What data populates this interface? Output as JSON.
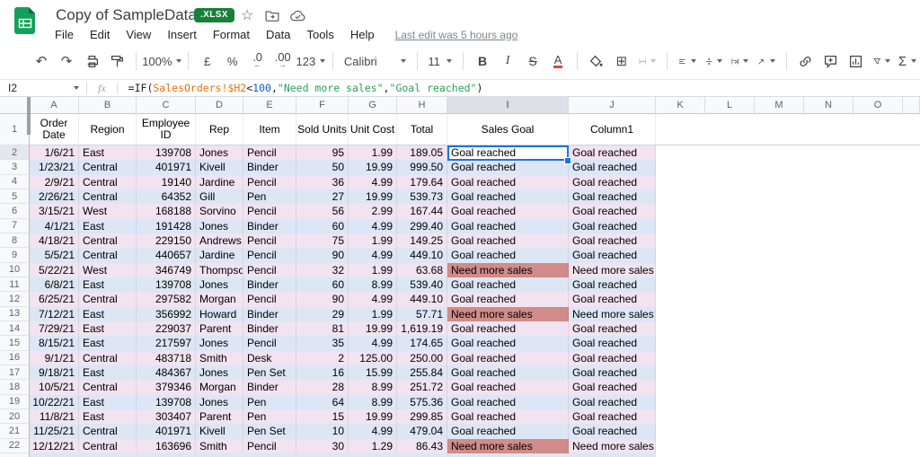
{
  "titlebar": {
    "title": "Copy of SampleData",
    "badge": ".XLSX"
  },
  "icons": {
    "star": "☆",
    "undo": "↶",
    "redo": "↷",
    "borders": "⊞",
    "sum": "Σ",
    "arrow_left": "←",
    "arrow_right": "→"
  },
  "menubar": {
    "items": [
      "File",
      "Edit",
      "View",
      "Insert",
      "Format",
      "Data",
      "Tools",
      "Help"
    ],
    "last_edit": "Last edit was 5 hours ago"
  },
  "toolbar": {
    "zoom": "100%",
    "currency": "£",
    "percent": "%",
    "decrease_decimal": ".0",
    "increase_decimal": ".00",
    "number_format": "123",
    "font": "Calibri",
    "font_size": "11",
    "bold": "B",
    "italic": "I",
    "strikethrough": "S",
    "text_color": "A"
  },
  "formula_bar": {
    "cell_ref": "I2",
    "fx_label": "fx",
    "formula_parts": [
      {
        "t": "=IF(",
        "c": "plain"
      },
      {
        "t": "SalesOrders!$H2",
        "c": "range"
      },
      {
        "t": "<",
        "c": "plain"
      },
      {
        "t": "100",
        "c": "number"
      },
      {
        "t": ",",
        "c": "plain"
      },
      {
        "t": "\"Need more sales\"",
        "c": "string"
      },
      {
        "t": ",",
        "c": "plain"
      },
      {
        "t": "\"Goal reached\"",
        "c": "string"
      },
      {
        "t": ")",
        "c": "plain"
      }
    ]
  },
  "colors": {
    "band_pink": "#f1e3f0",
    "band_blue": "#dce6f5",
    "alert_red": "#d18b88",
    "selection": "#1a73e8",
    "badge_green": "#188038",
    "selected_cell_bg": "#ffffff",
    "formula_plain": "#202124",
    "formula_range": "#e8710a",
    "formula_number": "#1155cc",
    "formula_string": "#2e9e57"
  },
  "sheet": {
    "column_letters": [
      "A",
      "B",
      "C",
      "D",
      "E",
      "F",
      "G",
      "H",
      "I",
      "J",
      "K",
      "L",
      "M",
      "N",
      "O"
    ],
    "selected_column": "I",
    "selected_row": 2,
    "selected_cell": "I2",
    "alert_text": "Need more sales",
    "header_row": [
      "Order Date",
      "Region",
      "Employee ID",
      "Rep",
      "Item",
      "Sold Units",
      "Unit Cost",
      "Total",
      "Sales Goal",
      "Column1"
    ],
    "rows": [
      [
        "1/6/21",
        "East",
        "139708",
        "Jones",
        "Pencil",
        "95",
        "1.99",
        "189.05",
        "Goal reached",
        "Goal reached"
      ],
      [
        "1/23/21",
        "Central",
        "401971",
        "Kivell",
        "Binder",
        "50",
        "19.99",
        "999.50",
        "Goal reached",
        "Goal reached"
      ],
      [
        "2/9/21",
        "Central",
        "19140",
        "Jardine",
        "Pencil",
        "36",
        "4.99",
        "179.64",
        "Goal reached",
        "Goal reached"
      ],
      [
        "2/26/21",
        "Central",
        "64352",
        "Gill",
        "Pen",
        "27",
        "19.99",
        "539.73",
        "Goal reached",
        "Goal reached"
      ],
      [
        "3/15/21",
        "West",
        "168188",
        "Sorvino",
        "Pencil",
        "56",
        "2.99",
        "167.44",
        "Goal reached",
        "Goal reached"
      ],
      [
        "4/1/21",
        "East",
        "191428",
        "Jones",
        "Binder",
        "60",
        "4.99",
        "299.40",
        "Goal reached",
        "Goal reached"
      ],
      [
        "4/18/21",
        "Central",
        "229150",
        "Andrews",
        "Pencil",
        "75",
        "1.99",
        "149.25",
        "Goal reached",
        "Goal reached"
      ],
      [
        "5/5/21",
        "Central",
        "440657",
        "Jardine",
        "Pencil",
        "90",
        "4.99",
        "449.10",
        "Goal reached",
        "Goal reached"
      ],
      [
        "5/22/21",
        "West",
        "346749",
        "Thompson",
        "Pencil",
        "32",
        "1.99",
        "63.68",
        "Need more sales",
        "Need more sales"
      ],
      [
        "6/8/21",
        "East",
        "139708",
        "Jones",
        "Binder",
        "60",
        "8.99",
        "539.40",
        "Goal reached",
        "Goal reached"
      ],
      [
        "6/25/21",
        "Central",
        "297582",
        "Morgan",
        "Pencil",
        "90",
        "4.99",
        "449.10",
        "Goal reached",
        "Goal reached"
      ],
      [
        "7/12/21",
        "East",
        "356992",
        "Howard",
        "Binder",
        "29",
        "1.99",
        "57.71",
        "Need more sales",
        "Need more sales"
      ],
      [
        "7/29/21",
        "East",
        "229037",
        "Parent",
        "Binder",
        "81",
        "19.99",
        "1,619.19",
        "Goal reached",
        "Goal reached"
      ],
      [
        "8/15/21",
        "East",
        "217597",
        "Jones",
        "Pencil",
        "35",
        "4.99",
        "174.65",
        "Goal reached",
        "Goal reached"
      ],
      [
        "9/1/21",
        "Central",
        "483718",
        "Smith",
        "Desk",
        "2",
        "125.00",
        "250.00",
        "Goal reached",
        "Goal reached"
      ],
      [
        "9/18/21",
        "East",
        "484367",
        "Jones",
        "Pen Set",
        "16",
        "15.99",
        "255.84",
        "Goal reached",
        "Goal reached"
      ],
      [
        "10/5/21",
        "Central",
        "379346",
        "Morgan",
        "Binder",
        "28",
        "8.99",
        "251.72",
        "Goal reached",
        "Goal reached"
      ],
      [
        "10/22/21",
        "East",
        "139708",
        "Jones",
        "Pen",
        "64",
        "8.99",
        "575.36",
        "Goal reached",
        "Goal reached"
      ],
      [
        "11/8/21",
        "East",
        "303407",
        "Parent",
        "Pen",
        "15",
        "19.99",
        "299.85",
        "Goal reached",
        "Goal reached"
      ],
      [
        "11/25/21",
        "Central",
        "401971",
        "Kivell",
        "Pen Set",
        "10",
        "4.99",
        "479.04",
        "Goal reached",
        "Goal reached"
      ],
      [
        "12/12/21",
        "Central",
        "163696",
        "Smith",
        "Pencil",
        "30",
        "1.29",
        "86.43",
        "Need more sales",
        "Need more sales"
      ]
    ]
  }
}
